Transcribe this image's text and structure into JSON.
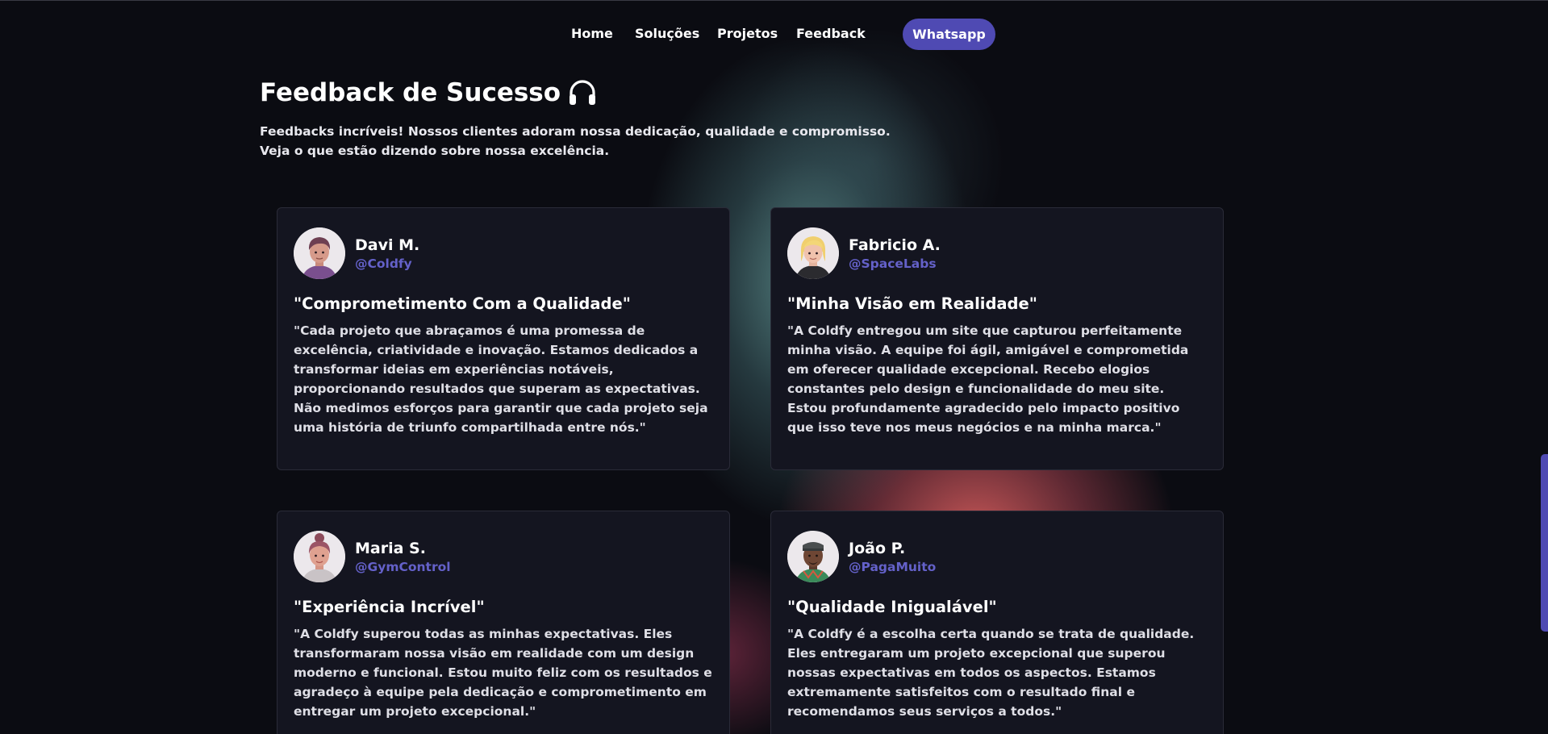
{
  "nav": {
    "home": "Home",
    "solucoes": "Soluções",
    "projetos": "Projetos",
    "feedback": "Feedback",
    "whatsapp": "Whatsapp"
  },
  "header": {
    "title": "Feedback de Sucesso",
    "title_icon": "headphones-icon",
    "subtitle_line1": "Feedbacks incríveis! Nossos clientes adoram nossa dedicação, qualidade e compromisso.",
    "subtitle_line2": "Veja o que estão dizendo sobre nossa excelência."
  },
  "testimonials": [
    {
      "name": "Davi M.",
      "handle": "@Coldfy",
      "avatar": "avatar-male-purple-shirt",
      "title": "\"Comprometimento Com a Qualidade\"",
      "text": "\"Cada projeto que abraçamos é uma promessa de excelência, criatividade e inovação. Estamos dedicados a transformar ideias em experiências notáveis, proporcionando resultados que superam as expectativas. Não medimos esforços para garantir que cada projeto seja uma história de triunfo compartilhada entre nós.\""
    },
    {
      "name": "Fabricio A.",
      "handle": "@SpaceLabs",
      "avatar": "avatar-blonde-black-shirt",
      "title": "\"Minha Visão em Realidade\"",
      "text": "\"A Coldfy entregou um site que capturou perfeitamente minha visão. A equipe foi ágil, amigável e comprometida em oferecer qualidade excepcional. Recebo elogios constantes pelo design e funcionalidade do meu site. Estou profundamente agradecido pelo impacto positivo que isso teve nos meus negócios e na minha marca.\""
    },
    {
      "name": "Maria S.",
      "handle": "@GymControl",
      "avatar": "avatar-female-bun",
      "title": "\"Experiência Incrível\"",
      "text": "\"A Coldfy superou todas as minhas expectativas. Eles transformaram nossa visão em realidade com um design moderno e funcional. Estou muito feliz com os resultados e agradeço à equipe pela dedicação e comprometimento em entregar um projeto excepcional.\""
    },
    {
      "name": "João P.",
      "handle": "@PagaMuito",
      "avatar": "avatar-male-cap-green",
      "title": "\"Qualidade Inigualável\"",
      "text": "\"A Coldfy é a escolha certa quando se trata de qualidade. Eles entregaram um projeto excepcional que superou nossas expectativas em todos os aspectos. Estamos extremamente satisfeitos com o resultado final e recomendamos seus serviços a todos.\""
    }
  ],
  "colors": {
    "accent": "#4f4ab3",
    "handle": "#6461c9",
    "card_bg": "#141520",
    "page_bg": "#0b0c12"
  }
}
